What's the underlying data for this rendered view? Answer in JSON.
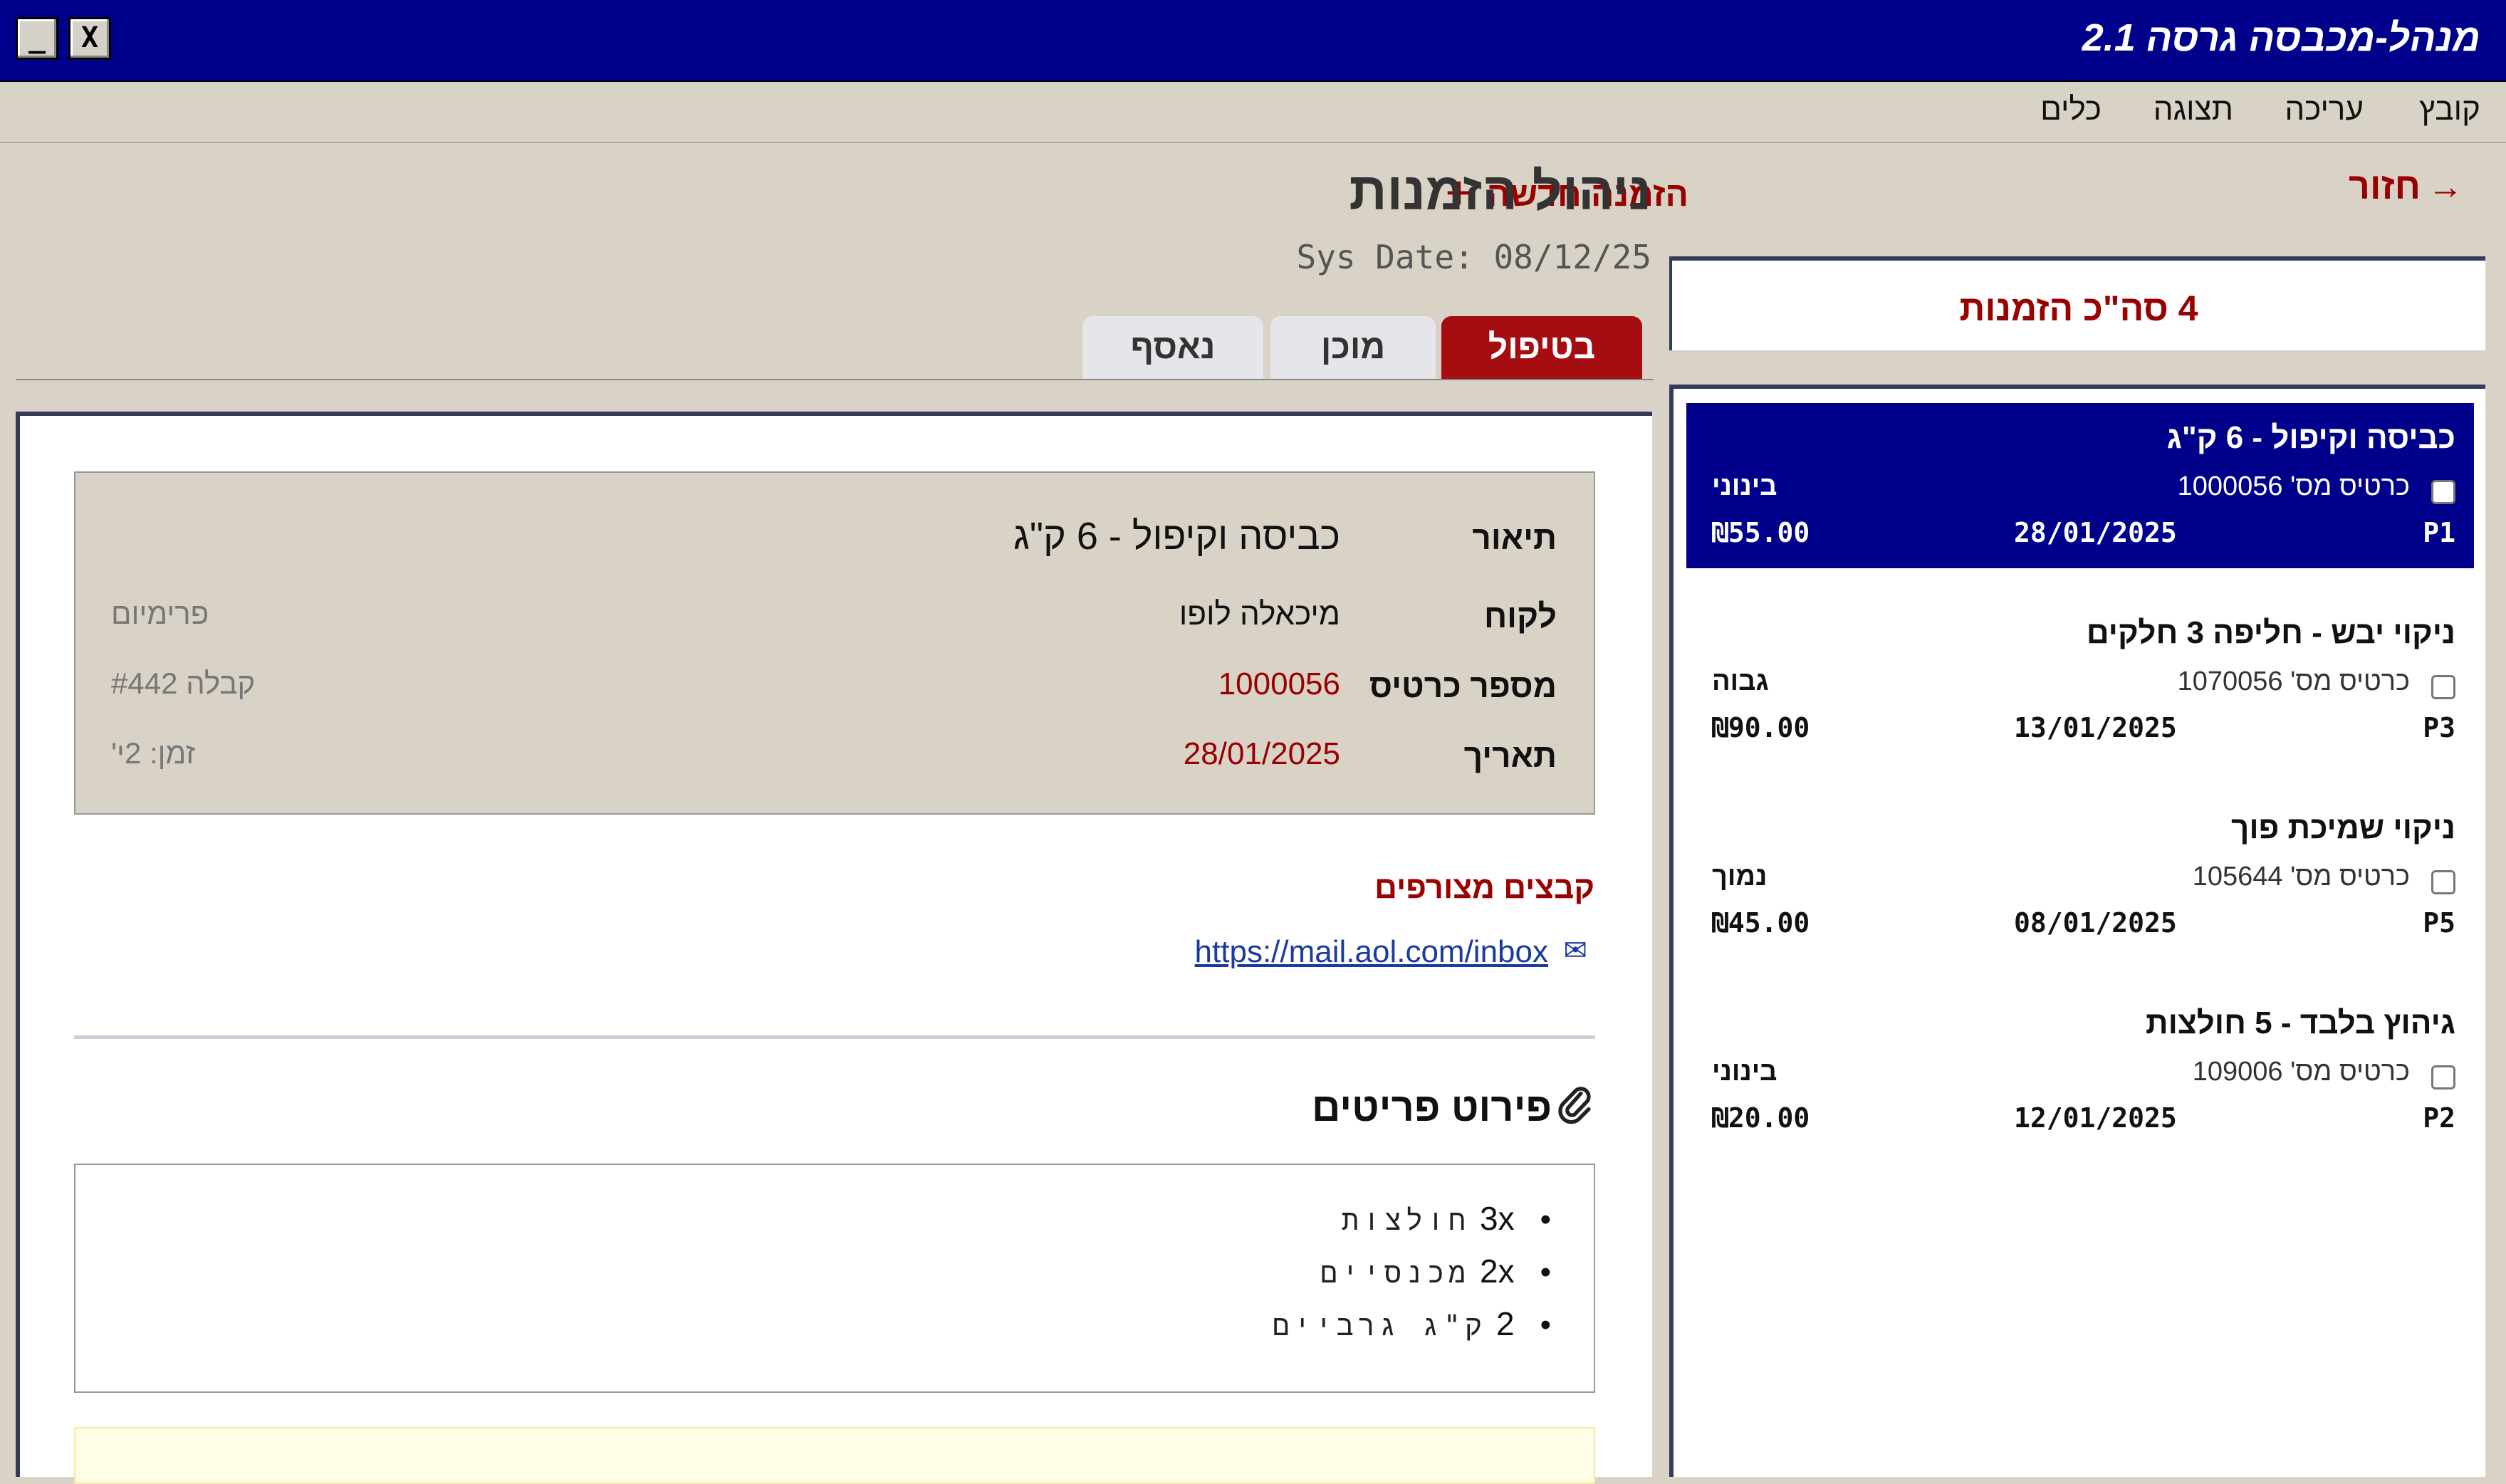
{
  "window": {
    "title": "מנהל-מכבסה גרסה 2.1",
    "minimize_label": "_",
    "close_label": "X"
  },
  "menu": [
    "קובץ",
    "עריכה",
    "תצוגה",
    "כלים"
  ],
  "header": {
    "back_label": "חזור",
    "back_arrow": "→",
    "new_order_label": "הזמנה חדשה",
    "new_order_plus": "+",
    "page_title": "ניהול הזמנות",
    "sys_date": "Sys Date: 08/12/25"
  },
  "tabs": [
    {
      "label": "בטיפול",
      "active": true
    },
    {
      "label": "מוכן",
      "active": false
    },
    {
      "label": "נאסף",
      "active": false
    }
  ],
  "sidebar": {
    "total_label": "4 סה\"כ הזמנות",
    "orders": [
      {
        "title": "כביסה וקיפול - 6 ק\"ג",
        "card": "כרטיס מס' 1000056",
        "priority_word": "בינוני",
        "priority_code": "P1",
        "date": "28/01/2025",
        "price": "₪55.00",
        "selected": true
      },
      {
        "title": "ניקוי יבש - חליפה 3 חלקים",
        "card": "כרטיס מס' 1070056",
        "priority_word": "גבוה",
        "priority_code": "P3",
        "date": "13/01/2025",
        "price": "₪90.00",
        "selected": false
      },
      {
        "title": "ניקוי שמיכת פוך",
        "card": "כרטיס מס' 105644",
        "priority_word": "נמוך",
        "priority_code": "P5",
        "date": "08/01/2025",
        "price": "₪45.00",
        "selected": false
      },
      {
        "title": "גיהוץ בלבד - 5 חולצות",
        "card": "כרטיס מס' 109006",
        "priority_word": "בינוני",
        "priority_code": "P2",
        "date": "12/01/2025",
        "price": "₪20.00",
        "selected": false
      }
    ]
  },
  "detail": {
    "description_label": "תיאור",
    "description_value": "כביסה וקיפול - 6 ק\"ג",
    "customer_label": "לקוח",
    "customer_value": "מיכאלה לופו",
    "customer_meta": "פרימיום",
    "card_label": "מספר כרטיס",
    "card_value": "1000056",
    "card_meta": "קבלה #442",
    "date_label": "תאריך",
    "date_value": "28/01/2025",
    "date_meta": "זמן: 2י'",
    "files_heading": "קבצים מצורפים",
    "file_link": "https://mail.aol.com/inbox",
    "items_heading": "פירוט פריטים",
    "items": [
      {
        "qty": "3x",
        "name": "חולצות"
      },
      {
        "qty": "2x",
        "name": "מכנסיים"
      },
      {
        "qty": "2",
        "name": "ק\"ג גרביים"
      }
    ]
  },
  "colors": {
    "titlebar": "#00008b",
    "accent_red": "#990000",
    "panel_bg": "#d9d2c7",
    "link_blue": "#1a3a9e"
  }
}
